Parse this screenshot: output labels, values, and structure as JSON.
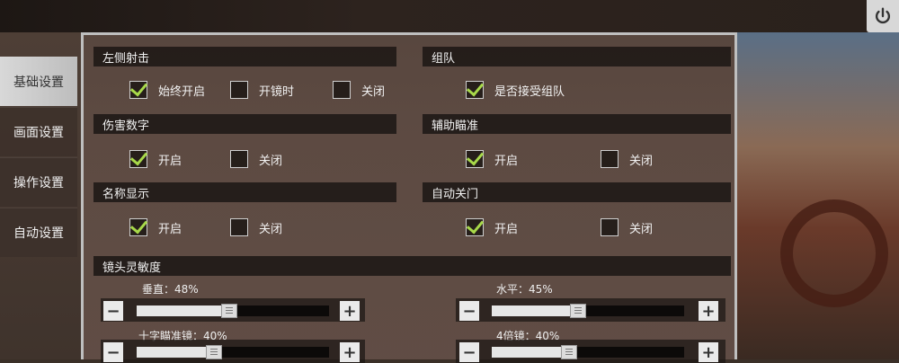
{
  "sidebar": {
    "tabs": [
      {
        "label": "基础设置",
        "active": true
      },
      {
        "label": "画面设置",
        "active": false
      },
      {
        "label": "操作设置",
        "active": false
      },
      {
        "label": "自动设置",
        "active": false
      }
    ]
  },
  "sections": {
    "left_fire": {
      "title": "左侧射击",
      "options": [
        {
          "label": "始终开启",
          "checked": true
        },
        {
          "label": "开镜时",
          "checked": false
        },
        {
          "label": "关闭",
          "checked": false
        }
      ]
    },
    "team": {
      "title": "组队",
      "options": [
        {
          "label": "是否接受组队",
          "checked": true
        }
      ]
    },
    "damage": {
      "title": "伤害数字",
      "options": [
        {
          "label": "开启",
          "checked": true
        },
        {
          "label": "关闭",
          "checked": false
        }
      ]
    },
    "aim_assist": {
      "title": "辅助瞄准",
      "options": [
        {
          "label": "开启",
          "checked": true
        },
        {
          "label": "关闭",
          "checked": false
        }
      ]
    },
    "names": {
      "title": "名称显示",
      "options": [
        {
          "label": "开启",
          "checked": true
        },
        {
          "label": "关闭",
          "checked": false
        }
      ]
    },
    "auto_door": {
      "title": "自动关门",
      "options": [
        {
          "label": "开启",
          "checked": true
        },
        {
          "label": "关闭",
          "checked": false
        }
      ]
    },
    "sensitivity": {
      "title": "镜头灵敏度",
      "sliders": [
        {
          "label": "垂直：48%",
          "value": 48
        },
        {
          "label": "水平：45%",
          "value": 45
        },
        {
          "label": "十字瞄准镜：40%",
          "value": 40
        },
        {
          "label": "4倍镜：40%",
          "value": 40
        }
      ]
    }
  },
  "controls": {
    "minus": "−",
    "plus": "+"
  },
  "icons": {
    "power": "power-icon",
    "check": "checkmark-icon"
  },
  "colors": {
    "check": "#a8d94a",
    "header_bg": "#1e1816"
  }
}
